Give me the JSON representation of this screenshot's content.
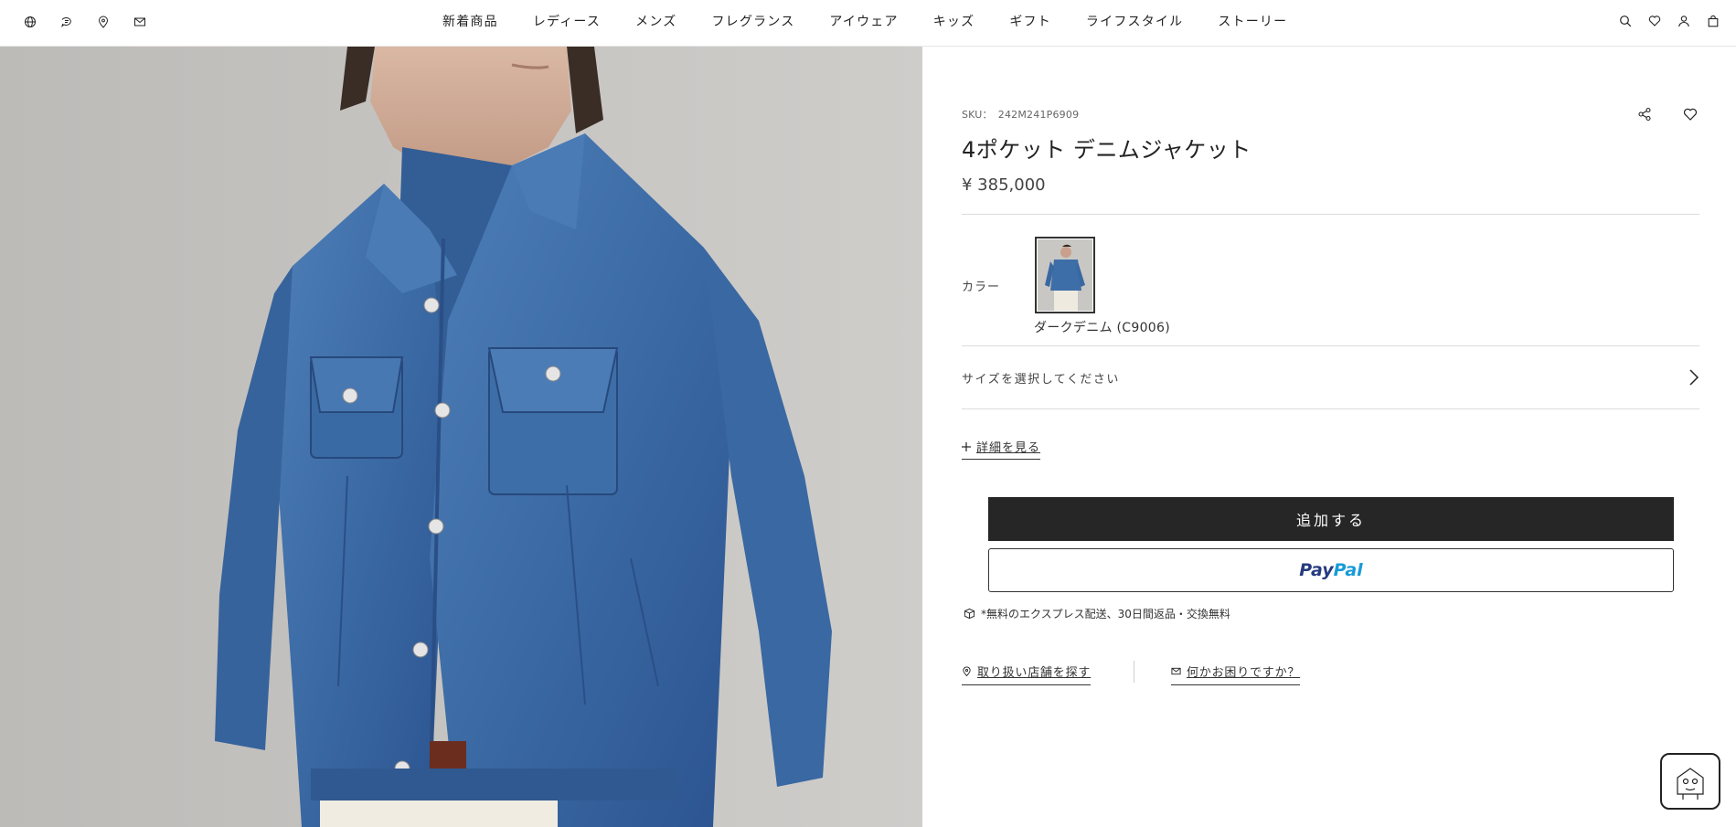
{
  "header": {
    "left_icons": [
      {
        "name": "globe-icon"
      },
      {
        "name": "contact-bubble-icon"
      },
      {
        "name": "location-pin-icon"
      },
      {
        "name": "mail-icon"
      }
    ],
    "nav": [
      {
        "label": "新着商品"
      },
      {
        "label": "レディース"
      },
      {
        "label": "メンズ"
      },
      {
        "label": "フレグランス"
      },
      {
        "label": "アイウェア"
      },
      {
        "label": "キッズ"
      },
      {
        "label": "ギフト"
      },
      {
        "label": "ライフスタイル"
      },
      {
        "label": "ストーリー"
      }
    ],
    "right_icons": [
      {
        "name": "search-icon"
      },
      {
        "name": "heart-icon"
      },
      {
        "name": "user-icon"
      },
      {
        "name": "shopping-bag-icon"
      }
    ]
  },
  "product": {
    "sku_label": "SKU：",
    "sku": "242M241P6909",
    "title": "4ポケット デニムジャケット",
    "price": "¥ 385,000",
    "color_label": "カラー",
    "color_name": "ダークデニム (C9006)",
    "size_prompt": "サイズを選択してください",
    "details_link": "詳細を見る",
    "add_button": "追加する",
    "paypal_pay": "Pay",
    "paypal_pal": "Pal",
    "shipping_note": "*無料のエクスプレス配送、30日間返品・交換無料",
    "store_link": "取り扱い店舗を探す",
    "help_link": "何かお困りですか？"
  },
  "colors": {
    "accent": "#262626",
    "denim": "#3d6ea8",
    "background_gray": "#c6c4c2",
    "paypal_dark": "#253b80",
    "paypal_light": "#179bd7"
  }
}
